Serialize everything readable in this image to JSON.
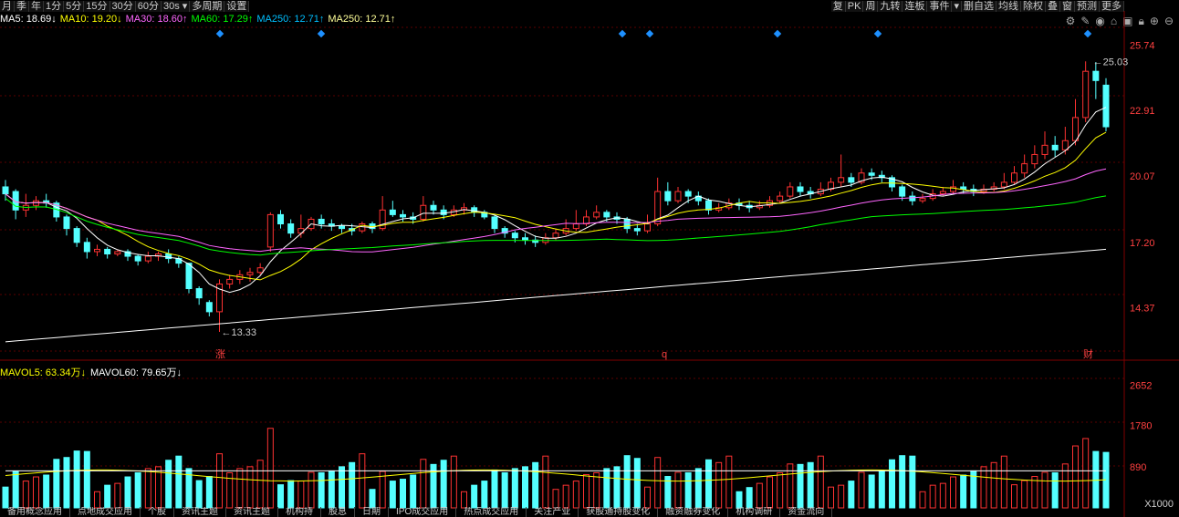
{
  "toolbar_left": [
    "月",
    "季",
    "年",
    "1分",
    "5分",
    "15分",
    "30分",
    "60分",
    "30s ▾",
    "多周期",
    "设置"
  ],
  "toolbar_right": [
    "复",
    "PK",
    "周",
    "九转",
    "连板",
    "事件",
    "▾",
    "删自选",
    "均线",
    "除权",
    "叠",
    "窗",
    "预测",
    "更多"
  ],
  "ma_legend": [
    {
      "label": "MA5: 18.69↓",
      "color": "#ffffff"
    },
    {
      "label": "MA10: 19.20↓",
      "color": "#ffff00"
    },
    {
      "label": "MA30: 18.60↑",
      "color": "#ff66ff"
    },
    {
      "label": "MA60: 17.29↑",
      "color": "#00ff00"
    },
    {
      "label": "MA250: 12.71↑",
      "color": "#00bfff"
    },
    {
      "label": "MA250: 12.71↑",
      "color": "#ffff99"
    }
  ],
  "vol_legend": [
    {
      "label": "MAVOL5: 63.34万↓",
      "color": "#ffff00"
    },
    {
      "label": "MAVOL60: 79.65万↓",
      "color": "#ffffff"
    }
  ],
  "price_axis": [
    "25.74",
    "22.91",
    "20.07",
    "17.20",
    "14.37"
  ],
  "vol_axis": [
    "2652",
    "1780",
    "890"
  ],
  "vol_unit": "X1000",
  "high_label": "25.03",
  "low_label": "13.33",
  "markers": [
    "涨",
    "q",
    "财"
  ],
  "bottom_tabs": [
    "备用概念应用",
    "点地成交应用",
    "个股",
    "资讯主题",
    "资讯主题",
    "机构持",
    "股息",
    "日期",
    "IPO成交应用",
    "热点成交应用",
    "关注产业",
    "获股通持股变化",
    "融资融券变化",
    "机构调研",
    "资金流向"
  ],
  "chart_data": {
    "type": "candlestick",
    "price_range": [
      12.5,
      26.5
    ],
    "candles": [
      [
        19.6,
        19.3,
        19.9,
        19.0
      ],
      [
        19.4,
        18.6,
        19.5,
        18.2
      ],
      [
        18.6,
        18.8,
        19.3,
        18.3
      ],
      [
        18.8,
        19.0,
        19.2,
        18.6
      ],
      [
        19.0,
        18.9,
        19.3,
        18.7
      ],
      [
        18.9,
        18.3,
        19.0,
        18.1
      ],
      [
        18.3,
        17.8,
        18.4,
        17.5
      ],
      [
        17.8,
        17.2,
        17.9,
        17.0
      ],
      [
        17.2,
        16.8,
        17.4,
        16.5
      ],
      [
        16.8,
        16.9,
        17.1,
        16.6
      ],
      [
        16.9,
        16.7,
        17.0,
        16.5
      ],
      [
        16.7,
        16.8,
        16.9,
        16.6
      ],
      [
        16.8,
        16.6,
        16.9,
        16.4
      ],
      [
        16.6,
        16.4,
        16.7,
        16.2
      ],
      [
        16.4,
        16.6,
        16.8,
        16.3
      ],
      [
        16.6,
        16.7,
        16.8,
        16.4
      ],
      [
        16.7,
        16.5,
        16.9,
        16.3
      ],
      [
        16.5,
        16.3,
        16.6,
        16.1
      ],
      [
        16.3,
        15.2,
        16.3,
        15.0
      ],
      [
        15.2,
        14.8,
        15.3,
        14.5
      ],
      [
        14.6,
        14.2,
        14.7,
        14.0
      ],
      [
        14.2,
        15.4,
        15.6,
        13.33
      ],
      [
        15.4,
        15.6,
        15.8,
        15.2
      ],
      [
        15.6,
        15.8,
        16.0,
        15.4
      ],
      [
        15.8,
        15.9,
        16.1,
        15.5
      ],
      [
        15.9,
        16.1,
        16.3,
        15.8
      ],
      [
        17.0,
        18.4,
        18.5,
        16.8
      ],
      [
        18.4,
        18.0,
        18.6,
        17.8
      ],
      [
        18.0,
        17.6,
        18.2,
        17.4
      ],
      [
        17.6,
        17.8,
        18.4,
        17.4
      ],
      [
        17.8,
        18.2,
        18.3,
        17.7
      ],
      [
        18.2,
        18.0,
        18.4,
        17.8
      ],
      [
        18.0,
        17.9,
        18.2,
        17.7
      ],
      [
        17.9,
        17.8,
        18.0,
        17.6
      ],
      [
        17.8,
        17.7,
        18.0,
        17.5
      ],
      [
        17.7,
        18.0,
        18.1,
        17.6
      ],
      [
        18.0,
        17.8,
        18.1,
        17.6
      ],
      [
        17.8,
        18.6,
        19.2,
        17.7
      ],
      [
        18.6,
        18.4,
        19.0,
        18.3
      ],
      [
        18.4,
        18.3,
        18.6,
        18.1
      ],
      [
        18.3,
        18.2,
        18.5,
        18.0
      ],
      [
        18.2,
        18.8,
        19.2,
        18.1
      ],
      [
        18.8,
        18.6,
        19.0,
        18.4
      ],
      [
        18.6,
        18.4,
        18.8,
        18.2
      ],
      [
        18.4,
        18.6,
        18.8,
        18.3
      ],
      [
        18.6,
        18.7,
        18.9,
        18.4
      ],
      [
        18.7,
        18.5,
        18.8,
        18.3
      ],
      [
        18.5,
        18.3,
        18.6,
        18.2
      ],
      [
        18.3,
        17.8,
        18.4,
        17.6
      ],
      [
        17.8,
        17.6,
        17.9,
        17.4
      ],
      [
        17.6,
        17.4,
        17.7,
        17.2
      ],
      [
        17.4,
        17.3,
        17.6,
        17.1
      ],
      [
        17.3,
        17.2,
        17.5,
        17.0
      ],
      [
        17.2,
        17.4,
        17.6,
        17.1
      ],
      [
        17.4,
        17.6,
        17.8,
        17.3
      ],
      [
        17.6,
        17.8,
        18.2,
        17.5
      ],
      [
        17.8,
        18.0,
        18.6,
        17.7
      ],
      [
        18.0,
        18.3,
        18.6,
        17.9
      ],
      [
        18.3,
        18.5,
        18.8,
        18.2
      ],
      [
        18.5,
        18.3,
        18.6,
        18.1
      ],
      [
        18.3,
        18.2,
        18.5,
        18.0
      ],
      [
        18.2,
        17.8,
        18.3,
        17.6
      ],
      [
        17.8,
        17.7,
        18.0,
        17.5
      ],
      [
        17.7,
        18.0,
        18.4,
        17.6
      ],
      [
        18.0,
        19.4,
        20.0,
        17.9
      ],
      [
        19.4,
        19.0,
        19.8,
        18.8
      ],
      [
        19.0,
        19.4,
        19.6,
        18.9
      ],
      [
        19.4,
        19.2,
        19.5,
        18.9
      ],
      [
        19.2,
        19.0,
        19.4,
        18.8
      ],
      [
        19.0,
        18.6,
        19.1,
        18.4
      ],
      [
        18.6,
        18.7,
        18.9,
        18.5
      ],
      [
        18.7,
        18.9,
        19.1,
        18.6
      ],
      [
        18.9,
        18.8,
        19.1,
        18.6
      ],
      [
        18.8,
        18.7,
        19.0,
        18.5
      ],
      [
        18.7,
        18.8,
        19.0,
        18.6
      ],
      [
        18.8,
        19.0,
        19.2,
        18.7
      ],
      [
        19.0,
        19.2,
        19.4,
        18.9
      ],
      [
        19.2,
        19.6,
        19.8,
        19.1
      ],
      [
        19.6,
        19.4,
        19.8,
        19.2
      ],
      [
        19.4,
        19.3,
        19.6,
        19.1
      ],
      [
        19.3,
        19.5,
        19.8,
        19.2
      ],
      [
        19.5,
        19.8,
        20.0,
        19.4
      ],
      [
        19.8,
        20.0,
        21.0,
        19.6
      ],
      [
        20.0,
        19.8,
        20.2,
        19.6
      ],
      [
        19.8,
        20.2,
        20.4,
        19.7
      ],
      [
        20.2,
        20.1,
        20.4,
        19.9
      ],
      [
        20.1,
        20.0,
        20.3,
        19.8
      ],
      [
        20.0,
        19.6,
        20.1,
        19.4
      ],
      [
        19.6,
        19.2,
        19.7,
        19.0
      ],
      [
        19.2,
        19.0,
        19.4,
        18.8
      ],
      [
        19.0,
        19.1,
        19.3,
        18.9
      ],
      [
        19.1,
        19.3,
        19.5,
        19.0
      ],
      [
        19.3,
        19.4,
        19.6,
        19.2
      ],
      [
        19.4,
        19.6,
        19.9,
        19.3
      ],
      [
        19.6,
        19.5,
        19.8,
        19.3
      ],
      [
        19.5,
        19.4,
        19.7,
        19.2
      ],
      [
        19.4,
        19.5,
        19.7,
        19.3
      ],
      [
        19.5,
        19.6,
        19.8,
        19.4
      ],
      [
        19.6,
        19.8,
        20.2,
        19.5
      ],
      [
        19.8,
        20.2,
        20.5,
        19.7
      ],
      [
        20.2,
        20.6,
        21.0,
        20.0
      ],
      [
        20.6,
        21.0,
        21.4,
        20.4
      ],
      [
        21.0,
        21.4,
        22.0,
        20.8
      ],
      [
        21.4,
        21.2,
        21.8,
        20.9
      ],
      [
        21.2,
        21.6,
        22.2,
        21.0
      ],
      [
        21.6,
        22.6,
        23.4,
        21.4
      ],
      [
        22.6,
        24.6,
        25.03,
        22.4
      ],
      [
        24.6,
        24.2,
        25.0,
        23.4
      ],
      [
        24.0,
        22.2,
        24.3,
        22.0
      ]
    ]
  }
}
